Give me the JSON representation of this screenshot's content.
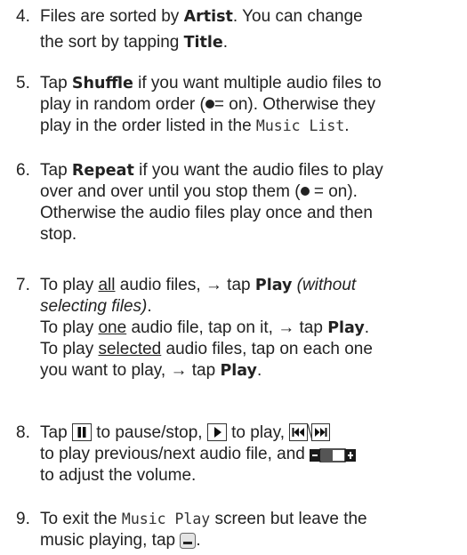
{
  "steps": [
    {
      "number": "4.",
      "t1": "Files are sorted by ",
      "b1": "Artist",
      "t2": ". You can change",
      "t3": "the sort by tapping ",
      "b2": "Title",
      "t4": "."
    },
    {
      "number": "5.",
      "t1": "Tap ",
      "b1": "Shuffle",
      "t2": " if you want multiple audio files to",
      "t3": "play in random order (",
      "t4": "= on). Otherwise they",
      "t5": "play in the order listed in the ",
      "m1": "Music List",
      "t6": "."
    },
    {
      "number": "6.",
      "t1": "Tap ",
      "b1": "Repeat",
      "t2": " if you want the audio files to play",
      "t3": "over and over until you stop them (",
      "t4": " = on).",
      "t5": "Otherwise the audio files play once and then",
      "t6": "stop."
    },
    {
      "number": "7.",
      "a1": "To play ",
      "a_u": "all",
      "a2": " audio files, → tap ",
      "a_b": "Play",
      "a_i1": "(without",
      "a_i2": "selecting files)",
      "a3": ".",
      "o1": "To play ",
      "o_u": "one",
      "o2": " audio file, tap on it, → tap ",
      "o_b": "Play",
      "o3": ".",
      "s1": "To play ",
      "s_u": "selected",
      "s2": " audio files, tap on each one",
      "s3": "you want to play, → tap ",
      "s_b": "Play",
      "s4": "."
    },
    {
      "number": "8.",
      "t1": "Tap ",
      "t2": " to pause/stop, ",
      "t3": " to play, ",
      "t4": "to play previous/next audio file, and ",
      "t5": "to adjust the volume."
    },
    {
      "number": "9.",
      "t1": "To exit the ",
      "m1": "Music Play",
      "t2": " screen but leave the",
      "t3": "music playing, tap ",
      "t4": "."
    }
  ],
  "icons": {
    "pause": "pause-icon",
    "play": "play-icon",
    "prev_next": "previous-next-icon",
    "volume": "volume-slider-icon",
    "minimize": "minimize-icon"
  },
  "colors": {
    "text": "#222222",
    "icon_border": "#333333"
  }
}
